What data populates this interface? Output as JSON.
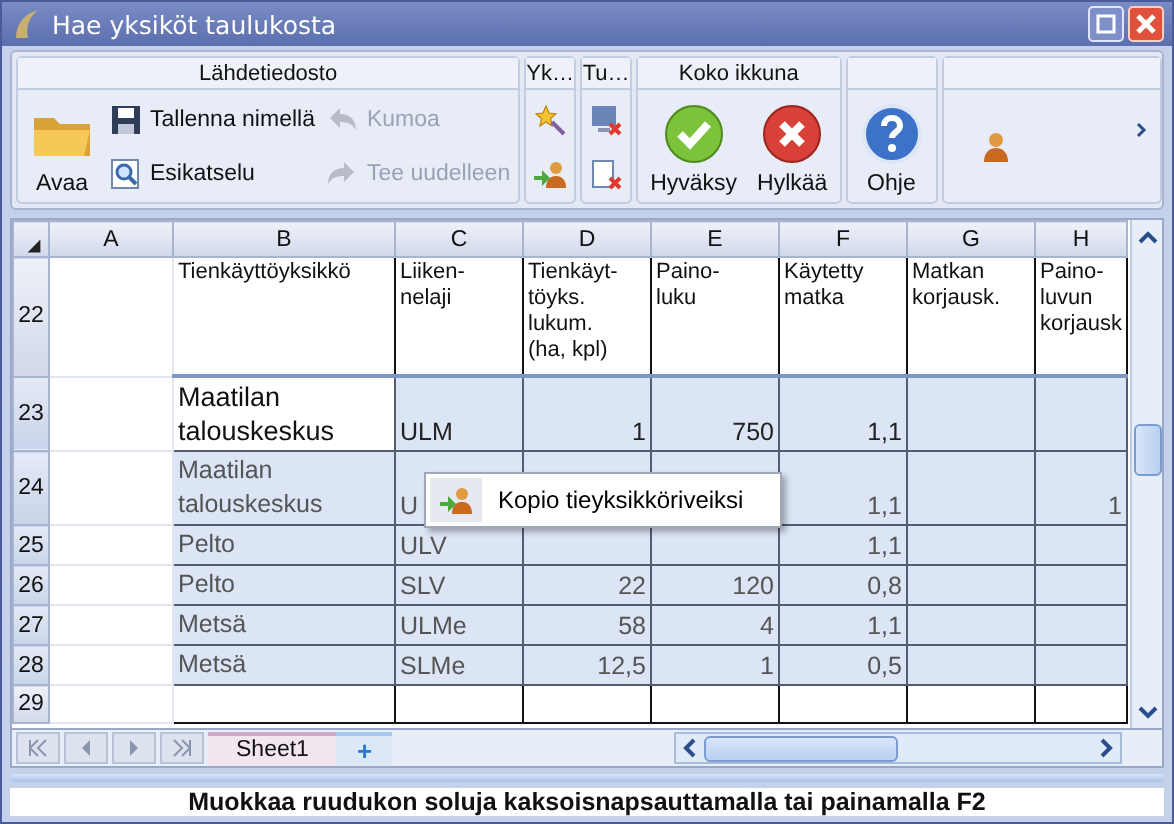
{
  "window": {
    "title": "Hae yksiköt taulukosta"
  },
  "ribbon": [
    {
      "title": "Lähdetiedosto",
      "items": [
        {
          "kind": "large",
          "label": "Avaa",
          "disabled": false
        },
        {
          "kind": "column",
          "items": [
            {
              "label": "Tallenna nimellä",
              "disabled": false
            },
            {
              "label": "Esikatselu",
              "disabled": false
            }
          ]
        },
        {
          "kind": "column",
          "items": [
            {
              "label": "Kumoa",
              "disabled": true
            },
            {
              "label": "Tee uudelleen",
              "disabled": true
            }
          ]
        }
      ]
    },
    {
      "title": "Yk…",
      "items": [
        {
          "kind": "iconcolumn",
          "items": [
            {
              "kind": "icon"
            },
            {
              "kind": "icon"
            }
          ]
        }
      ]
    },
    {
      "title": "Tu…",
      "items": [
        {
          "kind": "iconcolumn",
          "items": [
            {
              "kind": "icon"
            },
            {
              "kind": "icon"
            }
          ]
        }
      ]
    },
    {
      "title": "Koko ikkuna",
      "items": [
        {
          "kind": "large",
          "label": "Hyväksy",
          "disabled": false
        },
        {
          "kind": "large",
          "label": "Hylkää",
          "disabled": false
        }
      ]
    },
    {
      "items": [
        {
          "kind": "large",
          "label": "Ohje",
          "disabled": false
        }
      ]
    },
    {
      "items": [
        {
          "kind": "single"
        }
      ]
    }
  ],
  "grid": {
    "columns": [
      "A",
      "B",
      "C",
      "D",
      "E",
      "F",
      "G",
      "H"
    ],
    "rows": [
      {
        "number": "22",
        "kind": "header",
        "selected": false,
        "cells": [
          "",
          "Tienkäyttöyksikkö",
          "Liiken-\nnelaji",
          "Tienkäyt-\ntöyks.\nlukum.\n(ha, kpl)",
          "Paino-\nluku",
          "Käytetty\nmatka",
          "Matkan\nkorjausk.",
          "Paino-\nluvun\nkorjausk"
        ]
      },
      {
        "number": "23",
        "kind": "current",
        "selected": true,
        "cells": [
          "",
          "Maatilan\ntalouskeskus",
          "ULM",
          "1",
          "750",
          "1,1",
          "",
          ""
        ]
      },
      {
        "number": "24",
        "kind": "data",
        "selected": true,
        "cells": [
          "",
          "Maatilan\ntalouskeskus",
          "U",
          "",
          "",
          "1,1",
          "",
          "1"
        ]
      },
      {
        "number": "25",
        "kind": "data",
        "selected": true,
        "cells": [
          "",
          "Pelto",
          "ULV",
          "",
          "",
          "1,1",
          "",
          ""
        ]
      },
      {
        "number": "26",
        "kind": "data",
        "selected": true,
        "cells": [
          "",
          "Pelto",
          "SLV",
          "22",
          "120",
          "0,8",
          "",
          ""
        ]
      },
      {
        "number": "27",
        "kind": "data",
        "selected": true,
        "cells": [
          "",
          "Metsä",
          "ULMe",
          "58",
          "4",
          "1,1",
          "",
          ""
        ]
      },
      {
        "number": "28",
        "kind": "data",
        "selected": true,
        "cells": [
          "",
          "Metsä",
          "SLMe",
          "12,5",
          "1",
          "0,5",
          "",
          ""
        ]
      },
      {
        "number": "29",
        "kind": "blank",
        "selected": false,
        "cells": [
          "",
          "",
          "",
          "",
          "",
          "",
          "",
          ""
        ]
      }
    ]
  },
  "context_menu": {
    "items": [
      {
        "label": "Kopio tieyksikköriveiksi"
      }
    ]
  },
  "sheets": {
    "tabs": [
      {
        "label": "Sheet1",
        "selected": true
      }
    ],
    "add": "+"
  },
  "status_bar": "Muokkaa ruudukon soluja kaksoisnapsauttamalla tai painamalla F2"
}
